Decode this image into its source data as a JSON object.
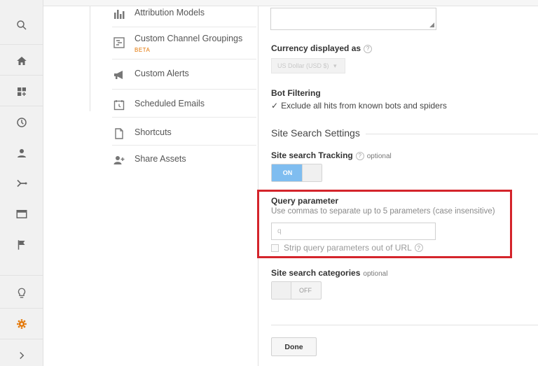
{
  "rail": {
    "items": [
      {
        "icon": "search-icon"
      },
      {
        "icon": "home-icon"
      },
      {
        "icon": "customization-icon"
      },
      {
        "icon": "clock-icon"
      },
      {
        "icon": "person-icon"
      },
      {
        "icon": "acquisition-icon"
      },
      {
        "icon": "behavior-icon"
      },
      {
        "icon": "flag-icon"
      },
      {
        "icon": "lightbulb-icon"
      },
      {
        "icon": "gear-icon"
      },
      {
        "icon": "chevron-right-icon"
      }
    ],
    "active_color": "#e37400"
  },
  "menu": {
    "items": [
      {
        "label": "Attribution Models",
        "icon": "bar-chart-icon"
      },
      {
        "label": "Custom Channel Groupings",
        "badge": "BETA",
        "icon": "channel-grouping-icon"
      },
      {
        "label": "Custom Alerts",
        "icon": "megaphone-icon"
      },
      {
        "label": "Scheduled Emails",
        "icon": "calendar-clock-icon"
      },
      {
        "label": "Shortcuts",
        "icon": "document-icon"
      },
      {
        "label": "Share Assets",
        "icon": "add-person-icon"
      }
    ]
  },
  "settings": {
    "currency": {
      "label": "Currency displayed as",
      "value": "US Dollar (USD $)"
    },
    "bot_filtering": {
      "label": "Bot Filtering",
      "checkbox_label": "Exclude all hits from known bots and spiders",
      "checked": true
    },
    "site_search": {
      "section_title": "Site Search Settings",
      "tracking_label": "Site search Tracking",
      "tracking_optional": "optional",
      "tracking_state": "ON",
      "query_parameter": {
        "label": "Query parameter",
        "description": "Use commas to separate up to 5 parameters (case insensitive)",
        "value": "q",
        "strip_label": "Strip query parameters out of URL",
        "strip_checked": false
      },
      "categories_label": "Site search categories",
      "categories_optional": "optional",
      "categories_state": "OFF"
    },
    "done_label": "Done",
    "highlight_color": "#d4242b",
    "toggle_on_color": "#7fbdf0"
  }
}
